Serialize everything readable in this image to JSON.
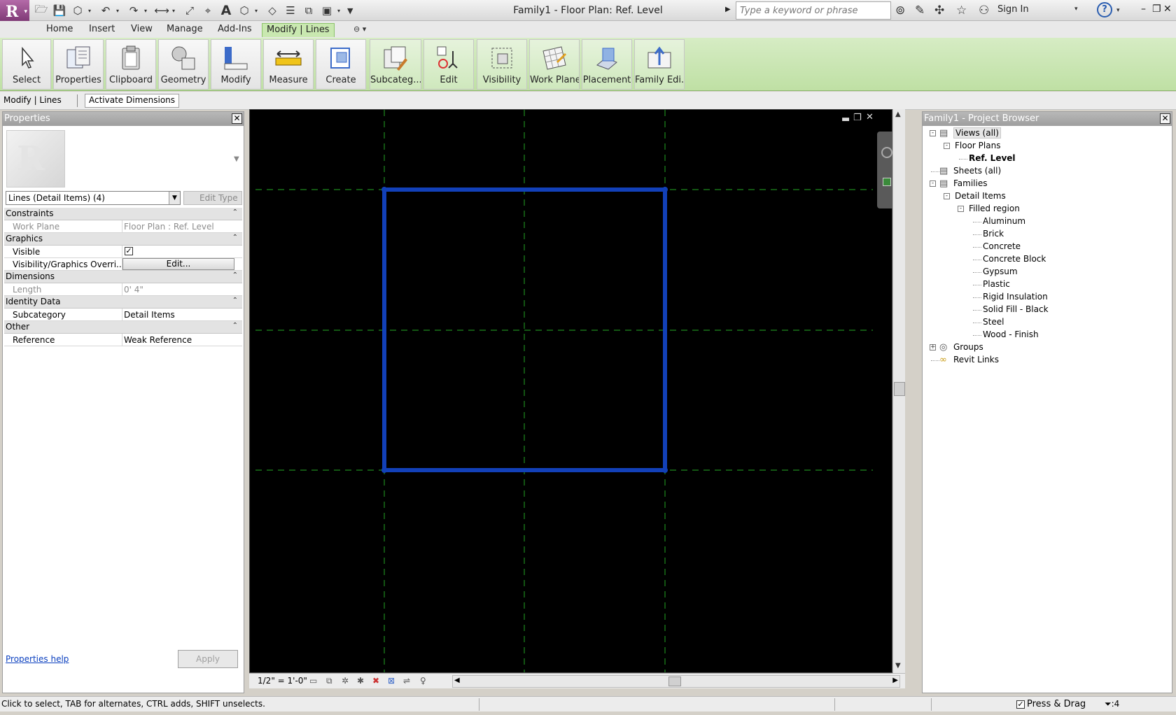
{
  "app": {
    "title": "Family1 - Floor Plan: Ref. Level",
    "search_placeholder": "Type a keyword or phrase",
    "sign_in": "Sign In",
    "help": "?"
  },
  "tabs": [
    {
      "label": "Home"
    },
    {
      "label": "Insert"
    },
    {
      "label": "View"
    },
    {
      "label": "Manage"
    },
    {
      "label": "Add-Ins"
    },
    {
      "label": "Modify | Lines",
      "active": true
    }
  ],
  "ribbon": [
    {
      "label": "Select",
      "icon": "cursor-icon"
    },
    {
      "label": "Properties",
      "icon": "properties-icon"
    },
    {
      "label": "Clipboard",
      "icon": "clipboard-icon"
    },
    {
      "label": "Geometry",
      "icon": "geometry-icon"
    },
    {
      "label": "Modify",
      "icon": "modify-icon"
    },
    {
      "label": "Measure",
      "icon": "measure-icon"
    },
    {
      "label": "Create",
      "icon": "create-icon"
    },
    {
      "label": "Subcateg...",
      "icon": "subcategory-icon"
    },
    {
      "label": "Edit",
      "icon": "edit-icon"
    },
    {
      "label": "Visibility",
      "icon": "visibility-icon"
    },
    {
      "label": "Work Plane",
      "icon": "work-plane-icon"
    },
    {
      "label": "Placement",
      "icon": "placement-icon"
    },
    {
      "label": "Family Edi...",
      "icon": "family-editor-icon"
    }
  ],
  "options_bar": {
    "context": "Modify | Lines",
    "activate_dimensions": "Activate Dimensions"
  },
  "properties": {
    "title": "Properties",
    "type_selector": "Lines (Detail Items) (4)",
    "edit_type": "Edit Type",
    "groups": [
      {
        "name": "Constraints",
        "rows": [
          {
            "key": "Work Plane",
            "value": "Floor Plan : Ref. Level",
            "readonly": true
          }
        ]
      },
      {
        "name": "Graphics",
        "rows": [
          {
            "key": "Visible",
            "value": "✓",
            "kind": "checkbox",
            "checked": true
          },
          {
            "key": "Visibility/Graphics Overri...",
            "value": "Edit...",
            "kind": "button"
          }
        ]
      },
      {
        "name": "Dimensions",
        "rows": [
          {
            "key": "Length",
            "value": "0'  4\"",
            "readonly": true
          }
        ]
      },
      {
        "name": "Identity Data",
        "rows": [
          {
            "key": "Subcategory",
            "value": "Detail Items"
          }
        ]
      },
      {
        "name": "Other",
        "rows": [
          {
            "key": "Reference",
            "value": "Weak Reference"
          }
        ]
      }
    ],
    "help_link": "Properties help",
    "apply": "Apply"
  },
  "view": {
    "scale": "1/2\" = 1'-0\"",
    "background": "#000000",
    "line_color": "#1240b8",
    "ref_plane_color": "#1f8a1f"
  },
  "browser": {
    "title": "Family1 - Project Browser",
    "nodes": [
      {
        "label": "Views (all)",
        "level": 0,
        "toggle": "-",
        "icon": "views-icon",
        "selected": true
      },
      {
        "label": "Floor Plans",
        "level": 1,
        "toggle": "-"
      },
      {
        "label": "Ref. Level",
        "level": 2,
        "bold": true
      },
      {
        "label": "Sheets (all)",
        "level": 0,
        "icon": "sheets-icon"
      },
      {
        "label": "Families",
        "level": 0,
        "toggle": "-",
        "icon": "families-icon"
      },
      {
        "label": "Detail Items",
        "level": 1,
        "toggle": "-"
      },
      {
        "label": "Filled region",
        "level": 2,
        "toggle": "-"
      },
      {
        "label": "Aluminum",
        "level": 3
      },
      {
        "label": "Brick",
        "level": 3
      },
      {
        "label": "Concrete",
        "level": 3
      },
      {
        "label": "Concrete Block",
        "level": 3
      },
      {
        "label": "Gypsum",
        "level": 3
      },
      {
        "label": "Plastic",
        "level": 3
      },
      {
        "label": "Rigid Insulation",
        "level": 3
      },
      {
        "label": "Solid Fill - Black",
        "level": 3
      },
      {
        "label": "Steel",
        "level": 3
      },
      {
        "label": "Wood - Finish",
        "level": 3
      },
      {
        "label": "Groups",
        "level": 0,
        "toggle": "+",
        "icon": "groups-icon"
      },
      {
        "label": "Revit Links",
        "level": 0,
        "icon": "links-icon"
      }
    ]
  },
  "status": {
    "text": "Click to select, TAB for alternates, CTRL adds, SHIFT unselects.",
    "press_drag": "Press & Drag",
    "filter_count": ":4"
  }
}
